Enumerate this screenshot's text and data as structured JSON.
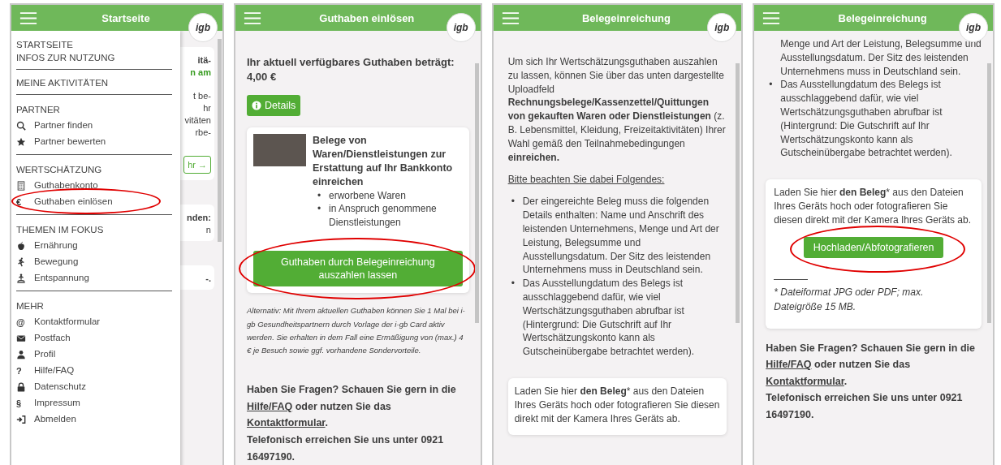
{
  "screens": [
    {
      "kind": "menu",
      "title": "Startseite",
      "logo": "igb",
      "menu": [
        {
          "items": [
            {
              "label": "STARTSEITE",
              "kind": "plain",
              "highlighted": false
            },
            {
              "label": "INFOS ZUR NUTZUNG",
              "kind": "plain",
              "highlighted": false
            }
          ]
        },
        {
          "items": [
            {
              "label": "MEINE AKTIVITÄTEN",
              "kind": "plain",
              "highlighted": false
            }
          ]
        },
        {
          "header": "PARTNER",
          "items": [
            {
              "label": "Partner finden",
              "kind": "search",
              "highlighted": false
            },
            {
              "label": "Partner bewerten",
              "kind": "star",
              "highlighted": false
            }
          ]
        },
        {
          "header": "WERTSCHÄTZUNG",
          "items": [
            {
              "label": "Guthabenkonto",
              "kind": "calculator",
              "highlighted": false
            },
            {
              "label": "Guthaben einlösen",
              "kind": "glyph",
              "glyph": "€",
              "highlighted": true
            }
          ]
        },
        {
          "header": "THEMEN IM FOKUS",
          "items": [
            {
              "label": "Ernährung",
              "kind": "apple",
              "highlighted": false
            },
            {
              "label": "Bewegung",
              "kind": "runner",
              "highlighted": false
            },
            {
              "label": "Entspannung",
              "kind": "meditation",
              "highlighted": false
            }
          ]
        },
        {
          "header": "MEHR",
          "items": [
            {
              "label": "Kontaktformular",
              "kind": "glyph",
              "glyph": "@",
              "highlighted": false
            },
            {
              "label": "Postfach",
              "kind": "envelope",
              "highlighted": false
            },
            {
              "label": "Profil",
              "kind": "user",
              "highlighted": false
            },
            {
              "label": "Hilfe/FAQ",
              "kind": "glyph",
              "glyph": "?",
              "highlighted": false
            },
            {
              "label": "Datenschutz",
              "kind": "lock",
              "highlighted": false
            },
            {
              "label": "Impressum",
              "kind": "glyph",
              "glyph": "§",
              "highlighted": false
            },
            {
              "label": "Abmelden",
              "kind": "logout",
              "highlighted": false
            }
          ]
        }
      ],
      "background": [
        {
          "lines": [
            {
              "text": "itä-",
              "kind": "bold"
            },
            {
              "text": "n am",
              "kind": "green"
            },
            {
              "text": "t be-",
              "kind": "plain"
            },
            {
              "text": "hr",
              "kind": "plain"
            },
            {
              "text": "vitäten",
              "kind": "plain"
            },
            {
              "text": "rbe-",
              "kind": "plain"
            }
          ],
          "button": "hr →"
        },
        {
          "lines": [
            {
              "text": "nden:",
              "kind": "bold"
            },
            {
              "text": "n",
              "kind": "plain"
            }
          ]
        },
        {
          "lines": [
            {
              "text": "-.",
              "kind": "bold"
            }
          ]
        }
      ]
    },
    {
      "kind": "page",
      "title": "Guthaben einlösen",
      "logo": "igb",
      "blocks": [
        {
          "kind": "heading",
          "text": "Ihr aktuell verfügbares Guthaben beträgt: 4,00 €"
        },
        {
          "kind": "details_button",
          "text": "Details"
        },
        {
          "kind": "offer_card",
          "title": "Belege von Waren/Dienstleistungen zur Erstattung auf Ihr Bankkonto einreichen",
          "bullets": [
            {
              "marker": "•",
              "text": "erworbene Waren"
            },
            {
              "marker": "•",
              "text": "in Anspruch genommene Dienstleistungen"
            }
          ],
          "button": "Guthaben durch Belegeinreichung auszahlen lassen",
          "highlighted": true
        },
        {
          "kind": "note",
          "text": "Alternativ: Mit Ihrem aktuellen Guthaben können Sie 1 Mal bei i-gb Gesundheitspartnern durch Vorlage der i-gb Card aktiv werden. Sie erhalten in dem Fall eine Ermäßigung von (max.) 4 € je Besuch sowie ggf. vorhandene Sondervorteile."
        },
        {
          "kind": "footer",
          "before": "Haben Sie Fragen? Schauen Sie gern in die",
          "link1": "Hilfe/FAQ",
          "middle": "oder nutzen Sie das",
          "link2": "Kontaktformular",
          "after": ".",
          "phone": "Telefonisch erreichen Sie uns unter 0921 16497190."
        }
      ]
    },
    {
      "kind": "page",
      "title": "Belegeinreichung",
      "logo": "igb",
      "blocks": [
        {
          "kind": "paragraph",
          "text": "Um sich Ihr Wertschätzungsguthaben auszahlen zu lassen, können Sie über das unten dargestellte Uploadfeld **Rechnungsbelege/Kassenzettel/Quittungen von gekauften Waren oder Dienstleistungen** (z. B. Lebensmittel, Kleidung, Freizeitaktivitäten) Ihrer Wahl gemäß den Teilnahmebedingungen **einreichen.**"
        },
        {
          "kind": "underlined",
          "text": "Bitte beachten Sie dabei Folgendes:"
        },
        {
          "kind": "bullets",
          "items": [
            {
              "marker": "•",
              "text": "Der eingereichte Beleg muss die folgenden Details enthalten: Name und Anschrift des leistenden Unternehmens, Menge und Art der Leistung, Belegsumme und Ausstellungsdatum. Der Sitz des leistenden Unternehmens muss in Deutschland sein."
            },
            {
              "marker": "•",
              "text": "Das Ausstellungdatum des Belegs ist ausschlaggebend dafür, wie viel Wertschätzungsguthaben abrufbar ist (Hintergrund: Die Gutschrift auf Ihr Wertschätzungskonto kann als Gutscheinübergabe betrachtet werden)."
            }
          ]
        },
        {
          "kind": "upload_card",
          "text": "Laden Sie hier **den Beleg*** aus den Dateien Ihres Geräts hoch oder fotografieren Sie diesen direkt mit der Kamera Ihres Geräts ab."
        }
      ]
    },
    {
      "kind": "page",
      "title": "Belegeinreichung",
      "logo": "igb",
      "blocks": [
        {
          "kind": "bullets",
          "items": [
            {
              "text": "Menge und Art der Leistung, Belegsumme und Ausstellungsdatum. Der Sitz des leistenden Unternehmens muss in Deutschland sein."
            },
            {
              "marker": "•",
              "text": "Das Ausstellungdatum des Belegs ist ausschlaggebend dafür, wie viel Wertschätzungsguthaben abrufbar ist (Hintergrund: Die Gutschrift auf Ihr Wertschätzungskonto kann als Gutscheinübergabe betrachtet werden)."
            }
          ]
        },
        {
          "kind": "upload_card",
          "text": "Laden Sie hier **den Beleg*** aus den Dateien Ihres Geräts hoch oder fotografieren Sie diesen direkt mit der Kamera Ihres Geräts ab.",
          "button": "Hochladen/Abfotografieren",
          "highlighted": true,
          "note": "* Dateiformat JPG oder PDF; max. Dateigröße 15 MB."
        },
        {
          "kind": "footer",
          "before": "Haben Sie Fragen? Schauen Sie gern in die",
          "link1": "Hilfe/FAQ",
          "middle": "oder nutzen Sie das",
          "link2": "Kontaktformular",
          "after": ".",
          "phone": "Telefonisch erreichen Sie uns unter 0921 16497190."
        }
      ]
    }
  ]
}
